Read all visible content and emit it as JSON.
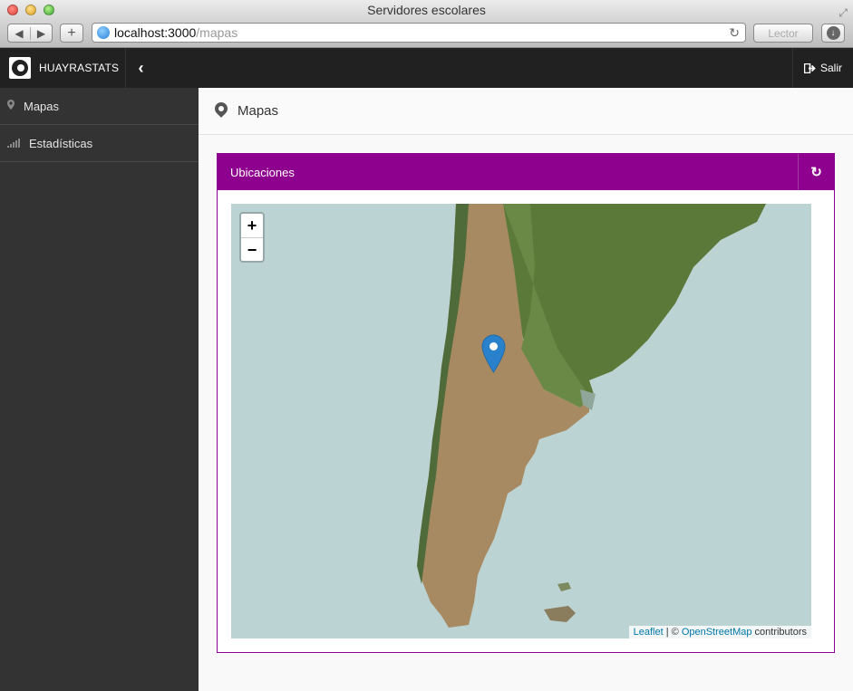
{
  "window": {
    "title": "Servidores escolares"
  },
  "browser": {
    "url_host": "localhost:3000",
    "url_path": "/mapas",
    "reader_label": "Lector"
  },
  "header": {
    "brand": "HUAYRASTATS",
    "logout_label": "Salir"
  },
  "sidebar": {
    "items": [
      {
        "label": "Mapas",
        "icon": "map-marker-icon"
      },
      {
        "label": "Estadísticas",
        "icon": "signal-bars-icon"
      }
    ]
  },
  "page": {
    "title": "Mapas"
  },
  "panel": {
    "title": "Ubicaciones",
    "accent_color": "#8e008e"
  },
  "map": {
    "zoom_in": "+",
    "zoom_out": "−",
    "attribution": {
      "leaflet": "Leaflet",
      "separator": " | © ",
      "osm": "OpenStreetMap",
      "suffix": " contributors"
    },
    "marker_color": "#2a81cb"
  }
}
